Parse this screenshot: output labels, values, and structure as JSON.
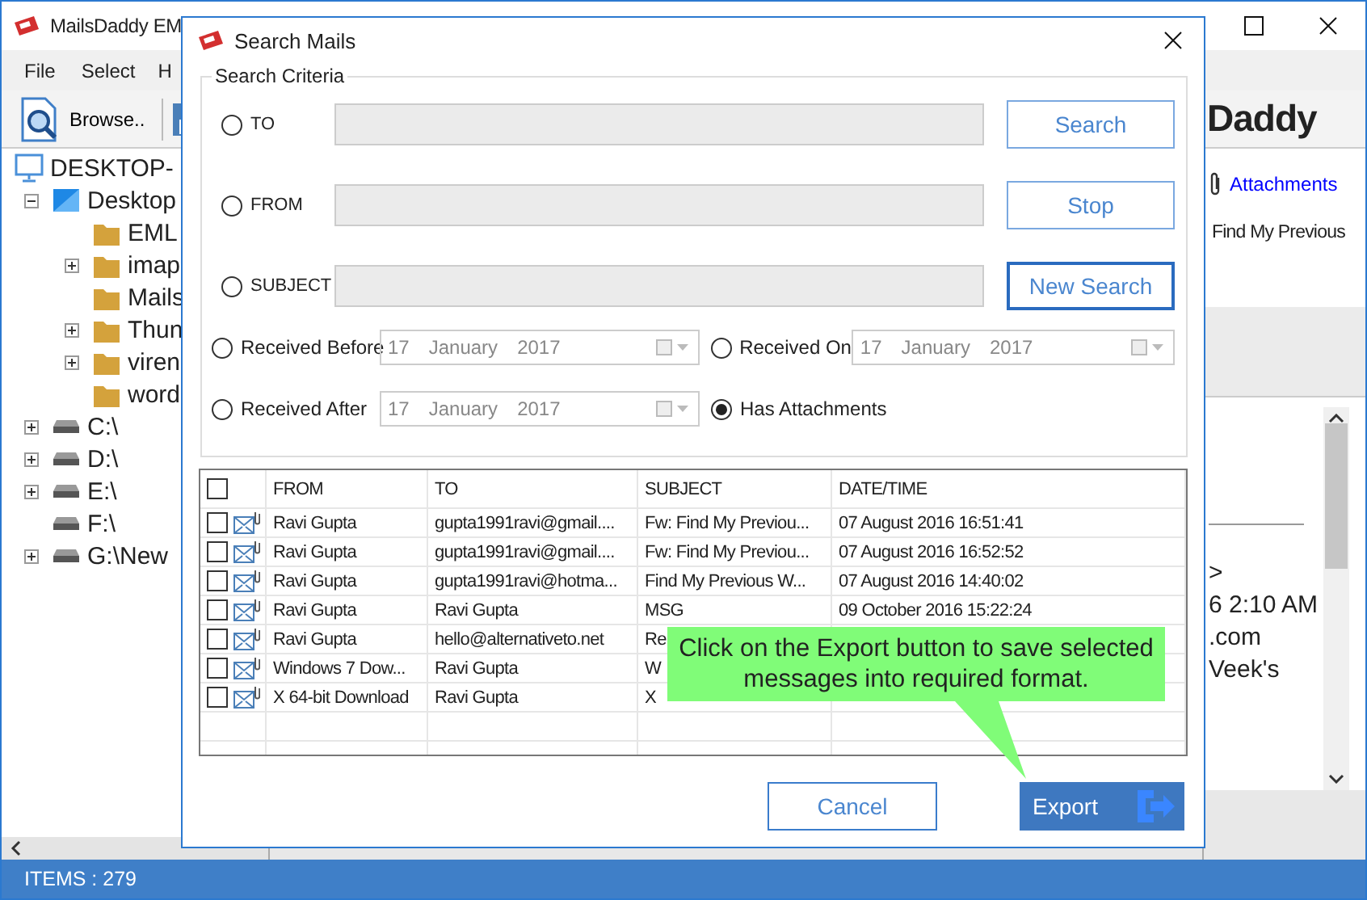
{
  "main_window": {
    "title": "MailsDaddy EM",
    "menu": [
      "File",
      "Select",
      "H"
    ],
    "toolbar": {
      "browse": "Browse.."
    },
    "logo": "Daddy",
    "tree": [
      {
        "label": "DESKTOP-",
        "kind": "computer",
        "children": [
          {
            "label": "Desktop",
            "kind": "desktop",
            "expanded": true,
            "children": [
              {
                "label": "EML",
                "kind": "folder"
              },
              {
                "label": "imap",
                "kind": "folder",
                "expanded": false
              },
              {
                "label": "Mails",
                "kind": "folder"
              },
              {
                "label": "Thun",
                "kind": "folder",
                "expanded": false
              },
              {
                "label": "viren",
                "kind": "folder",
                "expanded": false
              },
              {
                "label": "word",
                "kind": "folder"
              }
            ]
          },
          {
            "label": "C:\\",
            "kind": "drive",
            "expanded": false
          },
          {
            "label": "D:\\",
            "kind": "drive",
            "expanded": false
          },
          {
            "label": "E:\\",
            "kind": "drive",
            "expanded": false
          },
          {
            "label": "F:\\",
            "kind": "drive"
          },
          {
            "label": "G:\\New",
            "kind": "drive",
            "expanded": false
          }
        ]
      }
    ],
    "reader": {
      "attachments": "Attachments",
      "subject": "Find My Previous",
      "preview_lines": [
        ">",
        "6 2:10 AM",
        ".com",
        "Veek's"
      ]
    },
    "status": "ITEMS : 279"
  },
  "dialog": {
    "title": "Search Mails",
    "group": "Search Criteria",
    "criteria": [
      {
        "label": "TO",
        "selected": false,
        "button": "Search",
        "focused": false
      },
      {
        "label": "FROM",
        "selected": false,
        "button": "Stop",
        "focused": false
      },
      {
        "label": "SUBJECT",
        "selected": false,
        "button": "New Search",
        "focused": true
      }
    ],
    "date_rows": [
      [
        {
          "label": "Received Before",
          "selected": false,
          "date": {
            "day": "17",
            "month": "January",
            "year": "2017"
          }
        },
        {
          "label": "Received On",
          "selected": false,
          "date": {
            "day": "17",
            "month": "January",
            "year": "2017"
          }
        }
      ],
      [
        {
          "label": "Received After",
          "selected": false,
          "date": {
            "day": "17",
            "month": "January",
            "year": "2017"
          }
        },
        {
          "label": "Has Attachments",
          "selected": true
        }
      ]
    ],
    "table": {
      "all_checked": false,
      "columns": [
        "FROM",
        "TO",
        "SUBJECT",
        "DATE/TIME"
      ],
      "rows": [
        {
          "checked": false,
          "from": "Ravi Gupta",
          "to": "gupta1991ravi@gmail....",
          "subject": "Fw: Find My Previou...",
          "date": "07 August 2016 16:51:41"
        },
        {
          "checked": false,
          "from": "Ravi Gupta",
          "to": "gupta1991ravi@gmail....",
          "subject": "Fw: Find My Previou...",
          "date": "07 August 2016 16:52:52"
        },
        {
          "checked": false,
          "from": "Ravi Gupta",
          "to": "gupta1991ravi@hotma...",
          "subject": "Find My Previous W...",
          "date": "07 August 2016 14:40:02"
        },
        {
          "checked": false,
          "from": "Ravi Gupta",
          "to": "Ravi Gupta",
          "subject": "MSG",
          "date": "09 October 2016 15:22:24"
        },
        {
          "checked": false,
          "from": "Ravi Gupta",
          "to": "hello@alternativeto.net",
          "subject": "Re"
        },
        {
          "checked": false,
          "from": "Windows 7 Dow...",
          "to": "Ravi Gupta",
          "subject": "W"
        },
        {
          "checked": false,
          "from": "X 64-bit Download",
          "to": "Ravi Gupta",
          "subject": "X"
        }
      ]
    },
    "callout": "Click on the Export button to save selected messages into required format.",
    "cancel": "Cancel",
    "export": "Export"
  }
}
